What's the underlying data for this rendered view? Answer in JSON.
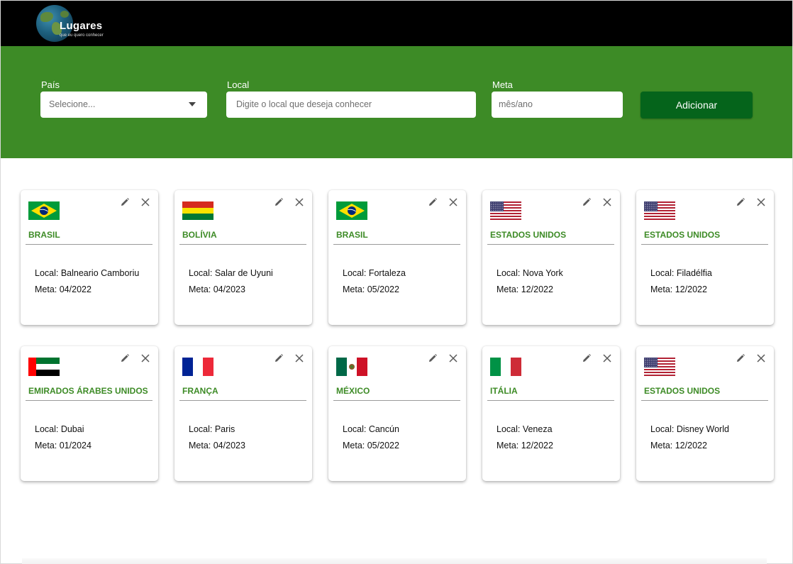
{
  "header": {
    "logo_title": "Lugares",
    "logo_subtitle": "que eu quero conhecer"
  },
  "form": {
    "country_label": "País",
    "country_value": "Selecione...",
    "place_label": "Local",
    "place_placeholder": "Digite o local que deseja conhecer",
    "goal_label": "Meta",
    "goal_placeholder": "mês/ano",
    "add_button": "Adicionar"
  },
  "colors": {
    "brand_green": "#3d8b26",
    "button_green": "#05641b",
    "header_black": "#000000"
  },
  "cards": [
    {
      "flag": "brazil",
      "country": "BRASIL",
      "place": "Local: Balneario Camboriu",
      "goal": "Meta: 04/2022"
    },
    {
      "flag": "bolivia",
      "country": "BOLÍVIA",
      "place": "Local: Salar de Uyuni",
      "goal": "Meta: 04/2023"
    },
    {
      "flag": "brazil",
      "country": "BRASIL",
      "place": "Local: Fortaleza",
      "goal": "Meta: 05/2022"
    },
    {
      "flag": "usa",
      "country": "ESTADOS UNIDOS",
      "place": "Local: Nova York",
      "goal": "Meta: 12/2022"
    },
    {
      "flag": "usa",
      "country": "ESTADOS UNIDOS",
      "place": "Local: Filadélfia",
      "goal": "Meta: 12/2022"
    },
    {
      "flag": "uae",
      "country": "EMIRADOS ÁRABES UNIDOS",
      "place": "Local: Dubai",
      "goal": "Meta: 01/2024"
    },
    {
      "flag": "france",
      "country": "FRANÇA",
      "place": "Local: Paris",
      "goal": "Meta: 04/2023"
    },
    {
      "flag": "mexico",
      "country": "MÉXICO",
      "place": "Local: Cancún",
      "goal": "Meta: 05/2022"
    },
    {
      "flag": "italy",
      "country": "ITÁLIA",
      "place": "Local: Veneza",
      "goal": "Meta: 12/2022"
    },
    {
      "flag": "usa",
      "country": "ESTADOS UNIDOS",
      "place": "Local: Disney World",
      "goal": "Meta: 12/2022"
    }
  ],
  "icons": {
    "edit": "pencil-icon",
    "delete": "close-icon"
  }
}
